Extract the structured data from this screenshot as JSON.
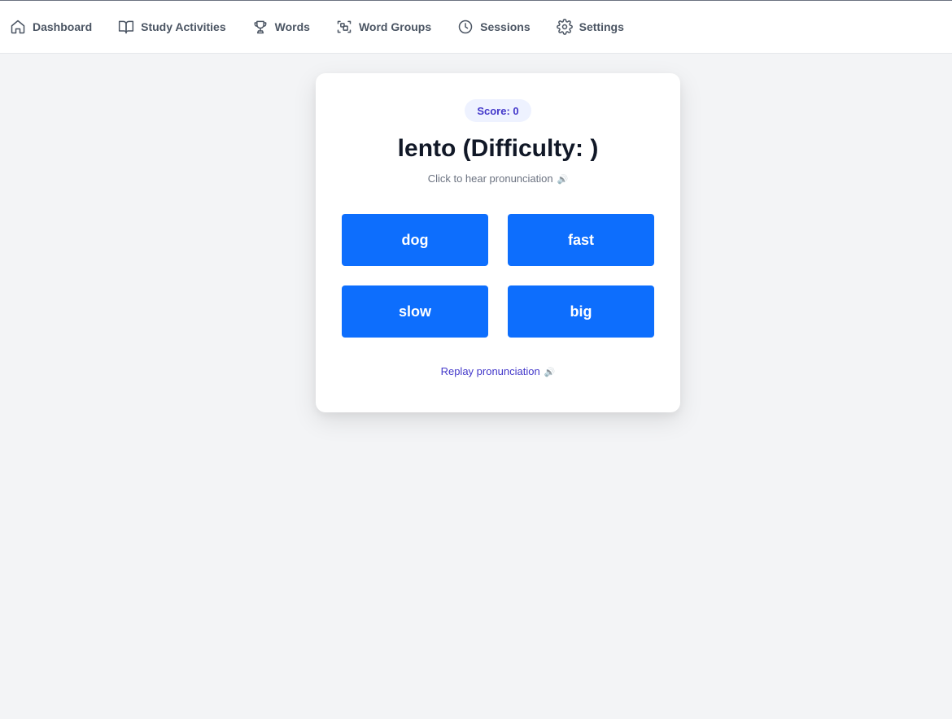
{
  "nav": {
    "items": [
      {
        "label": "Dashboard",
        "icon": "home-icon"
      },
      {
        "label": "Study Activities",
        "icon": "book-icon"
      },
      {
        "label": "Words",
        "icon": "trophy-icon"
      },
      {
        "label": "Word Groups",
        "icon": "scan-icon"
      },
      {
        "label": "Sessions",
        "icon": "clock-icon"
      },
      {
        "label": "Settings",
        "icon": "gear-icon"
      }
    ]
  },
  "quiz": {
    "score_label": "Score: 0",
    "word_title": "lento (Difficulty: )",
    "hint": "Click to hear pronunciation",
    "speaker_glyph": "🔊",
    "options": [
      "dog",
      "fast",
      "slow",
      "big"
    ],
    "replay_label": "Replay pronunciation"
  },
  "colors": {
    "accent": "#0d6efd",
    "badge_bg": "#eef2ff",
    "badge_text": "#4338ca",
    "page_bg": "#f3f4f6"
  }
}
